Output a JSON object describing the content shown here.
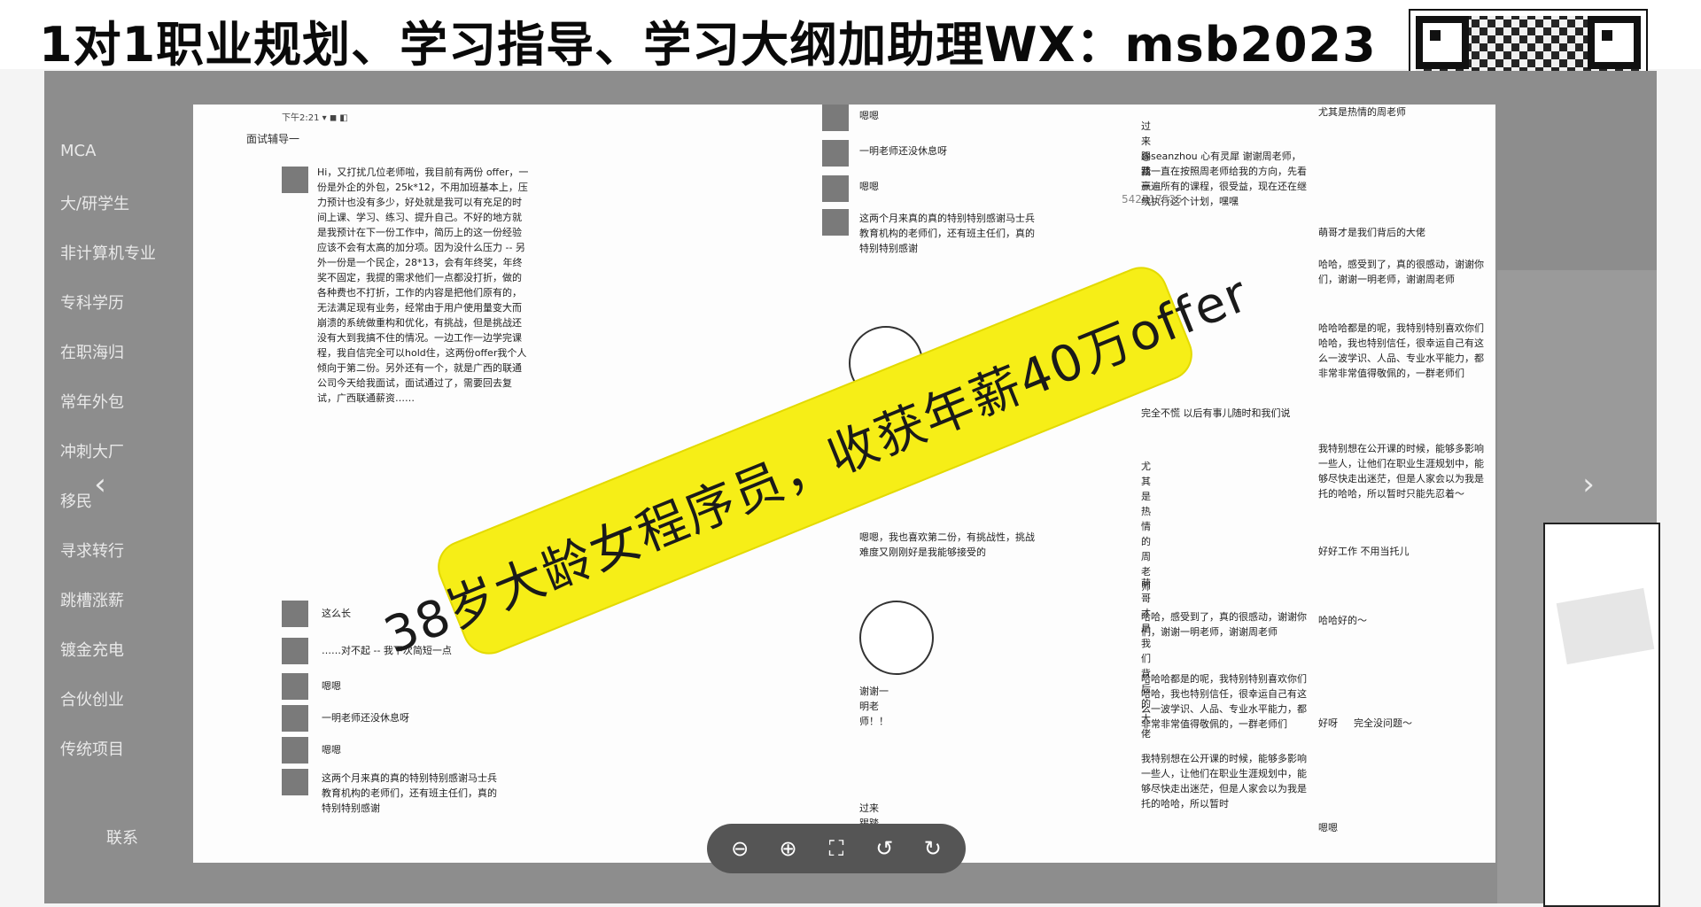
{
  "banner": {
    "text": "1对1职业规划、学习指导、学习大纲加助理WX：msb2023"
  },
  "sidebar": {
    "items": [
      {
        "label": "MCA"
      },
      {
        "label": "大/研学生"
      },
      {
        "label": "非计算机专业"
      },
      {
        "label": "专科学历"
      },
      {
        "label": "在职海归"
      },
      {
        "label": "常年外包"
      },
      {
        "label": "冲刺大厂"
      },
      {
        "label": "移民"
      },
      {
        "label": "寻求转行"
      },
      {
        "label": "跳槽涨薪"
      },
      {
        "label": "镀金充电"
      },
      {
        "label": "合伙创业"
      },
      {
        "label": "传统项目"
      },
      {
        "label": "联系"
      }
    ]
  },
  "chat": {
    "col1_title": "面试辅导一",
    "col1_msgs": [
      "Hi，又打扰几位老师啦，我目前有两份 offer，一份是外企的外包，25k*12，不用加班基本上，压力预计也没有多少，好处就是我可以有充足的时间上课、学习、练习、提升自己。不好的地方就是我预计在下一份工作中，简历上的这一份经验应该不会有太高的加分项。因为没什么压力 -- 另外一份是一个民企，28*13，会有年终奖，年终奖不固定，我提的需求他们一点都没打折，做的各种费也不打折，工作的内容是把他们原有的，无法满足现有业务，经常由于用户使用量变大而崩溃的系统做重构和优化，有挑战，但是挑战还没有大到我搞不住的情况。一边工作一边学完课程，我自信完全可以hold住，这两份offer我个人倾向于第二份。另外还有一个，就是广西的联通公司今天给我面试，面试通过了，需要回去复试，广西联通薪资……",
      "这么长",
      "……对不起 -- 我下次简短一点",
      "嗯嗯",
      "一明老师还没休息呀",
      "嗯嗯",
      "这两个月来真的真的特别特别感谢马士兵教育机构的老师们，还有班主任们，真的特别特别感谢"
    ],
    "col2_msgs": [
      "嗯嗯",
      "一明老师还没休息呀",
      "嗯嗯",
      "这两个月来真的真的特别特别感谢马士兵教育机构的老师们，还有班主任们，真的特别特别感谢",
      "嗯嗯，我也喜欢第二份，有挑战性，挑战难度又刚刚好是我能够接受的",
      "谢谢一明老师！！",
      "过来踢踏赢气"
    ],
    "col3_msgs": [
      "过来踢踏赢气",
      "@seanzhou 心有灵犀 谢谢周老师，我一直在按照周老师给我的方向，先看一遍所有的课程，很受益，现在还在继续执行这个计划，嘿嘿",
      "完全不慌 以后有事儿随时和我们说",
      "尤其是热情的周老师",
      "萌哥才是我们背后的大佬",
      "哈哈，感受到了，真的很感动，谢谢你们，谢谢一明老师，谢谢周老师",
      "哈哈哈都是的呢，我特别特别喜欢你们哈哈，我也特别信任，很幸运自己有这么一波学识、人品、专业水平能力，都非常非常值得敬佩的，一群老师们",
      "我特别想在公开课的时候，能够多影响一些人，让他们在职业生涯规划中，能够尽快走出迷茫，但是人家会以为我是托的哈哈，所以暂时"
    ],
    "col4_msgs": [
      "尤其是热情的周老师",
      "萌哥才是我们背后的大佬",
      "哈哈，感受到了，真的很感动，谢谢你们，谢谢一明老师，谢谢周老师",
      "哈哈哈都是的呢，我特别特别喜欢你们哈哈，我也特别信任，很幸运自己有这么一波学识、人品、专业水平能力，都非常非常值得敬佩的，一群老师们",
      "我特别想在公开课的时候，能够多影响一些人，让他们在职业生涯规划中，能够尽快走出迷茫，但是人家会以为我是托的哈哈，所以暂时只能先忍着～",
      "好好工作 不用当托儿",
      "哈哈好的～",
      "好呀",
      "完全没问题～",
      "嗯嗯"
    ],
    "watermark": "542717525"
  },
  "highlight": {
    "text": "38岁大龄女程序员，收获年薪40万offer"
  },
  "toolbar": {
    "zoom_out": "⊖",
    "zoom_in": "⊕",
    "fullscreen": "⛶",
    "rotate_left": "↺",
    "rotate_right": "↻"
  },
  "nav": {
    "prev": "‹",
    "next": "›"
  }
}
